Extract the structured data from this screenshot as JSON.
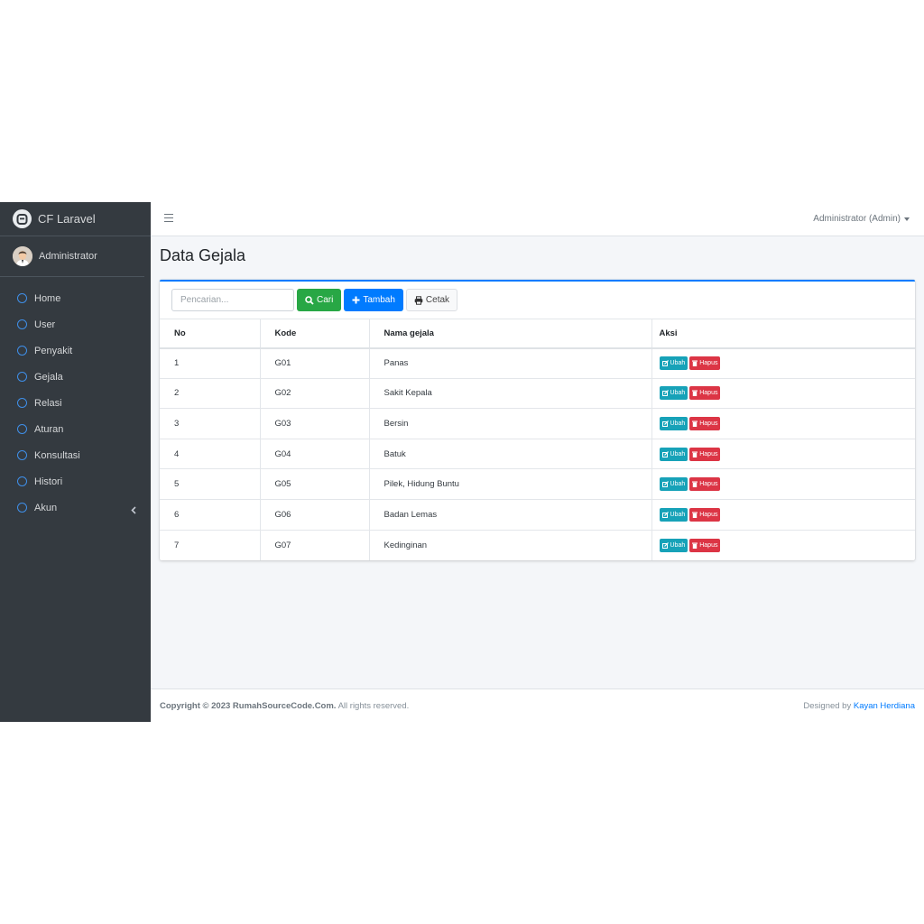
{
  "brand": {
    "name": "CF Laravel"
  },
  "user": {
    "name": "Administrator"
  },
  "sidebar": {
    "items": [
      {
        "label": "Home"
      },
      {
        "label": "User"
      },
      {
        "label": "Penyakit"
      },
      {
        "label": "Gejala"
      },
      {
        "label": "Relasi"
      },
      {
        "label": "Aturan"
      },
      {
        "label": "Konsultasi"
      },
      {
        "label": "Histori"
      },
      {
        "label": "Akun"
      }
    ]
  },
  "topbar": {
    "user_menu": "Administrator (Admin)"
  },
  "page": {
    "title": "Data Gejala"
  },
  "toolbar": {
    "search_placeholder": "Pencarian...",
    "search_value": "",
    "cari_label": "Cari",
    "tambah_label": "Tambah",
    "cetak_label": "Cetak"
  },
  "table": {
    "headers": [
      "No",
      "Kode",
      "Nama gejala",
      "Aksi"
    ],
    "rows": [
      {
        "no": "1",
        "kode": "G01",
        "nama": "Panas"
      },
      {
        "no": "2",
        "kode": "G02",
        "nama": "Sakit Kepala"
      },
      {
        "no": "3",
        "kode": "G03",
        "nama": "Bersin"
      },
      {
        "no": "4",
        "kode": "G04",
        "nama": "Batuk"
      },
      {
        "no": "5",
        "kode": "G05",
        "nama": "Pilek, Hidung Buntu"
      },
      {
        "no": "6",
        "kode": "G06",
        "nama": "Badan Lemas"
      },
      {
        "no": "7",
        "kode": "G07",
        "nama": "Kedinginan"
      }
    ],
    "action_edit": "Ubah",
    "action_delete": "Hapus"
  },
  "footer": {
    "copyright": "Copyright © 2023 RumahSourceCode.Com.",
    "rights": "All rights reserved.",
    "designed_by": "Designed by",
    "designer": "Kayan Herdiana"
  },
  "colors": {
    "sidebar_bg": "#343a40",
    "primary": "#007bff",
    "success": "#28a745",
    "info": "#17a2b8",
    "danger": "#dc3545",
    "nav_icon": "#3f8fe8"
  },
  "icons": {
    "brand": "logo-icon",
    "nav": "circle-outline-icon",
    "akun_chevron": "chevron-left-icon",
    "cari": "search-icon",
    "tambah": "plus-icon",
    "cetak": "print-icon",
    "ubah": "edit-icon",
    "hapus": "trash-icon"
  }
}
